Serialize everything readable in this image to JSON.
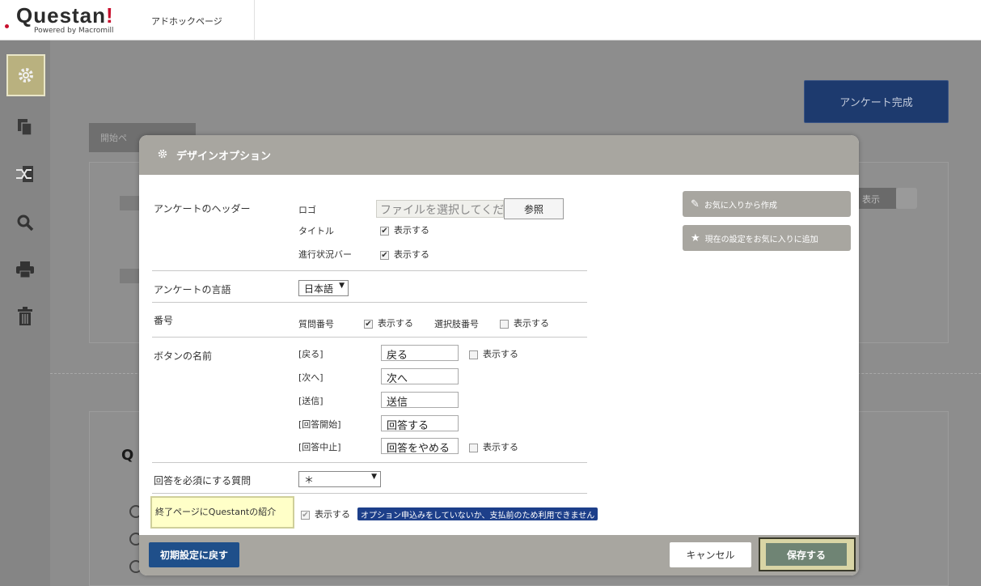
{
  "app": {
    "logo_text": "Questan",
    "logo_excl": "!",
    "logo_sub": "Powered by Macromill",
    "page_tab": "アドホックページ"
  },
  "palette": [
    "#a8111e",
    "#c97a82",
    "#d98a12",
    "#d4a412",
    "#7a9a16",
    "#2f8a2f",
    "#6fa8a8",
    "#1f58a8",
    "#5a2f8a",
    "#9a9a9a",
    "#2a2a2a"
  ],
  "sidebar": {
    "items": [
      {
        "icon": "gear-icon",
        "glyph": "⚙"
      },
      {
        "icon": "copy-icon",
        "glyph": "❐"
      },
      {
        "icon": "shuffle-icon",
        "glyph": "⤨"
      },
      {
        "icon": "search-icon",
        "glyph": "🔍"
      },
      {
        "icon": "print-icon",
        "glyph": "🖶"
      },
      {
        "icon": "trash-icon",
        "glyph": "🗑"
      }
    ]
  },
  "background": {
    "complete_button": "アンケート完成",
    "start_page_tag": "開始ペ",
    "display_label": "表示",
    "question_prefix": "Q"
  },
  "modal": {
    "title": "デザインオプション",
    "header_section": {
      "label": "アンケートのヘッダー",
      "logo_label": "ロゴ",
      "file_placeholder": "ファイルを選択してくださ",
      "browse_label": "参照",
      "title_label": "タイトル",
      "title_option": "表示する",
      "progress_label": "進行状況バー",
      "progress_option": "表示する"
    },
    "language_section": {
      "label": "アンケートの言語",
      "value": "日本語"
    },
    "number_section": {
      "label": "番号",
      "question_number_label": "質問番号",
      "question_number_option": "表示する",
      "choice_number_label": "選択肢番号",
      "choice_number_option": "表示する"
    },
    "button_names": {
      "label": "ボタンの名前",
      "back_label": "[戻る]",
      "back_value": "戻る",
      "back_option": "表示する",
      "next_label": "[次へ]",
      "next_value": "次へ",
      "submit_label": "[送信]",
      "submit_value": "送信",
      "start_label": "[回答開始]",
      "start_value": "回答する",
      "stop_label": "[回答中止]",
      "stop_value": "回答をやめる",
      "stop_option": "表示する"
    },
    "required_section": {
      "label": "回答を必須にする質問",
      "value": "＊"
    },
    "end_page": {
      "label": "終了ページにQuestantの紹介",
      "option": "表示する",
      "notice": "オプション申込みをしていないか、支払前のため利用できません"
    },
    "favorites": {
      "create": "お気に入りから作成",
      "add": "現在の設定をお気に入りに追加"
    },
    "footer": {
      "reset": "初期設定に戻す",
      "cancel": "キャンセル",
      "save": "保存する"
    }
  }
}
